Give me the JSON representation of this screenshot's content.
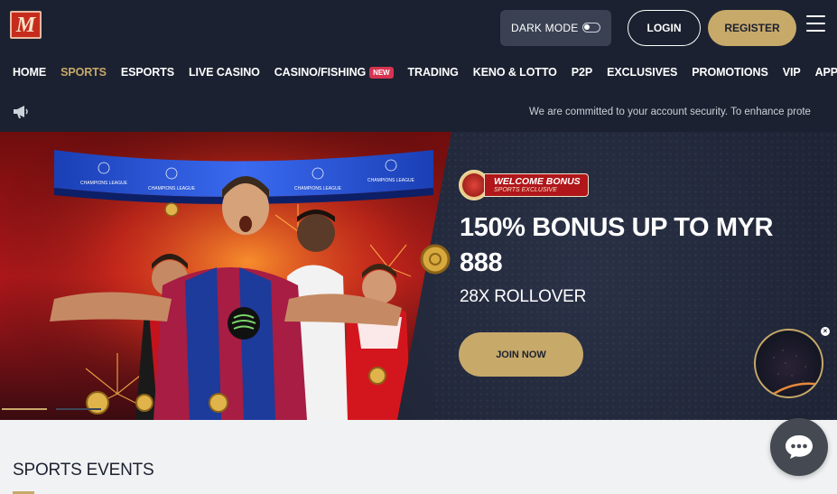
{
  "header": {
    "logo_text": "M",
    "dark_mode_label": "DARK MODE",
    "login_label": "LOGIN",
    "register_label": "REGISTER"
  },
  "nav": {
    "items": [
      {
        "label": "HOME"
      },
      {
        "label": "SPORTS",
        "active": true
      },
      {
        "label": "ESPORTS"
      },
      {
        "label": "LIVE CASINO"
      },
      {
        "label": "CASINO/FISHING",
        "badge": "NEW"
      },
      {
        "label": "TRADING"
      },
      {
        "label": "KENO & LOTTO"
      },
      {
        "label": "P2P"
      },
      {
        "label": "EXCLUSIVES"
      },
      {
        "label": "PROMOTIONS"
      },
      {
        "label": "VIP"
      },
      {
        "label": "APP"
      }
    ]
  },
  "announcement": {
    "text": "We are committed to your account security. To enhance prote"
  },
  "banner": {
    "badge_title": "WELCOME BONUS",
    "badge_subtitle": "SPORTS EXCLUSIVE",
    "headline_line1": "150% BONUS UP TO MYR",
    "headline_line2": "888",
    "subline": "28X ROLLOVER",
    "cta_label": "JOIN NOW",
    "hero_banner_texts": [
      "CHAMPIONS LEAGUE",
      "CHAMPIONS LEAGUE",
      "CHAMPIONS LEAGUE",
      "CHAMPIONS LEAGUE"
    ]
  },
  "sections": {
    "sports_events_title": "SPORTS EVENTS"
  },
  "colors": {
    "header_bg": "#1b2130",
    "accent_gold": "#c7a96a",
    "badge_new": "#d73351",
    "chat_bg": "#454a52"
  },
  "icons": {
    "announcement": "megaphone-icon",
    "menu": "hamburger-menu-icon",
    "chat": "chat-bubble-icon",
    "close": "close-icon"
  }
}
